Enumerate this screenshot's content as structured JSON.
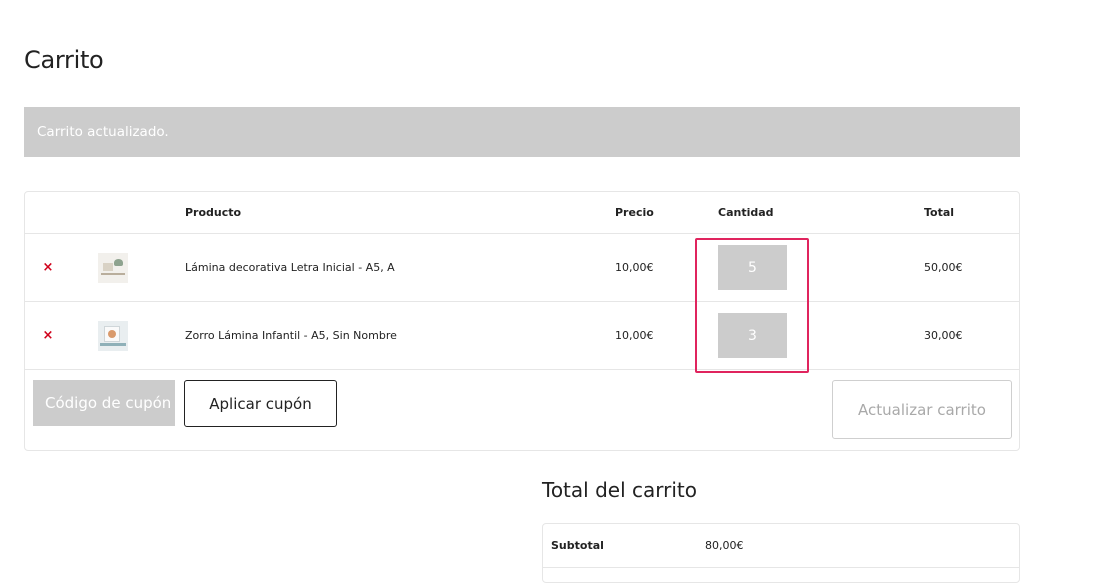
{
  "page": {
    "title": "Carrito",
    "notice": "Carrito actualizado."
  },
  "cart": {
    "headers": {
      "product": "Producto",
      "price": "Precio",
      "quantity": "Cantidad",
      "total": "Total"
    },
    "items": [
      {
        "remove": "×",
        "name": "Lámina decorativa Letra Inicial - A5, A",
        "price": "10,00€",
        "quantity": "5",
        "total": "50,00€"
      },
      {
        "remove": "×",
        "name": "Zorro Lámina Infantil - A5, Sin Nombre",
        "price": "10,00€",
        "quantity": "3",
        "total": "30,00€"
      }
    ],
    "coupon_placeholder": "Código de cupón",
    "apply_coupon_label": "Aplicar cupón",
    "update_cart_label": "Actualizar carrito"
  },
  "totals": {
    "title": "Total del carrito",
    "subtotal_label": "Subtotal",
    "subtotal_value": "80,00€"
  },
  "colors": {
    "highlight": "#e0245e",
    "remove": "#d0021b",
    "muted_fill": "#cccccc"
  }
}
